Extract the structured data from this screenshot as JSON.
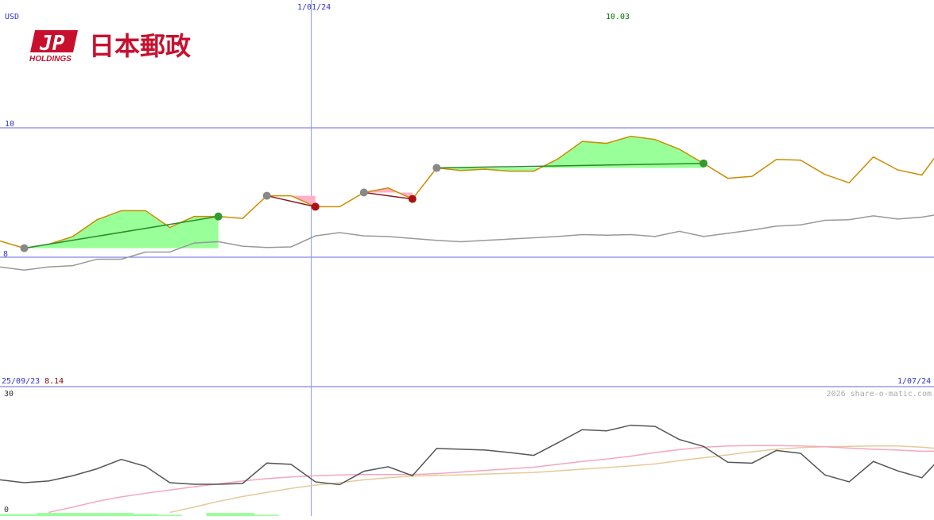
{
  "brand": {
    "logo_mark": "JP",
    "logo_sub": "HOLDINGS",
    "logo_name": "日本郵政",
    "brand_color": "#c8102e"
  },
  "chart_labels": {
    "currency": "USD",
    "date_mid": "1/01/24",
    "date_start": "25/09/23",
    "date_end": "1/07/24",
    "low_value": "8.14",
    "high_value": "10.03",
    "price_tick_10": "10",
    "price_tick_8": "8",
    "ind_tick_30": "30",
    "ind_tick_0": "0",
    "copyright": "2026 share-o-matic.com"
  },
  "colors": {
    "price": "#cc8c00",
    "benchmark": "#999999",
    "gain_fill": "#99ff99",
    "loss_fill": "#ffb0c8",
    "gain_line": "#2a8a2a",
    "loss_line": "#8b1a1a",
    "grid": "#6666dd",
    "indicator": "#555555",
    "ma_fast": "#f4a6bf",
    "ma_slow": "#e6c99a",
    "volume": "#99ff99",
    "high_text": "#007700",
    "low_text": "#8b0000"
  },
  "chart_data": [
    {
      "type": "line",
      "y_unit": "USD",
      "ylim": [
        7.0,
        10.6
      ],
      "grid_y": [
        8,
        10
      ],
      "x_count": 39,
      "x_marker_index": 13,
      "x_tick_labels": [
        {
          "index": 0,
          "label": "25/09/23"
        },
        {
          "index": 13,
          "label": "1/01/24"
        },
        {
          "index": 38,
          "label": "1/07/24"
        }
      ],
      "series": [
        {
          "key": "price",
          "values": [
            8.25,
            8.14,
            8.2,
            8.32,
            8.58,
            8.72,
            8.72,
            8.46,
            8.63,
            8.63,
            8.6,
            8.95,
            8.95,
            8.78,
            8.78,
            9.0,
            9.07,
            8.9,
            9.38,
            9.34,
            9.36,
            9.33,
            9.33,
            9.52,
            9.79,
            9.76,
            9.87,
            9.82,
            9.67,
            9.45,
            9.22,
            9.25,
            9.51,
            9.5,
            9.28,
            9.15,
            9.55,
            9.35,
            9.27,
            9.78
          ]
        },
        {
          "key": "benchmark",
          "values": [
            7.85,
            7.8,
            7.85,
            7.87,
            7.97,
            7.97,
            8.08,
            8.08,
            8.22,
            8.24,
            8.17,
            8.15,
            8.16,
            8.33,
            8.38,
            8.33,
            8.32,
            8.29,
            8.26,
            8.24,
            8.26,
            8.28,
            8.3,
            8.32,
            8.35,
            8.34,
            8.35,
            8.32,
            8.4,
            8.32,
            8.37,
            8.42,
            8.48,
            8.5,
            8.57,
            8.58,
            8.64,
            8.59,
            8.62,
            8.68
          ]
        }
      ],
      "trades": [
        {
          "start_index": 1,
          "end_index": 9,
          "result": "gain"
        },
        {
          "start_index": 11,
          "end_index": 13,
          "result": "loss"
        },
        {
          "start_index": 15,
          "end_index": 17,
          "result": "loss"
        },
        {
          "start_index": 18,
          "end_index": 29,
          "result": "gain"
        }
      ]
    },
    {
      "type": "line",
      "ylim": [
        0,
        30
      ],
      "series": [
        {
          "key": "indicator",
          "values": [
            8.5,
            7.8,
            8.2,
            9.5,
            11.2,
            13.5,
            11.8,
            7.8,
            7.4,
            7.4,
            7.6,
            12.6,
            12.3,
            8.0,
            7.3,
            10.6,
            11.7,
            9.5,
            16.2,
            16.0,
            15.8,
            15.2,
            14.5,
            17.6,
            20.8,
            20.5,
            21.9,
            21.6,
            18.4,
            16.7,
            12.8,
            12.6,
            15.7,
            15.0,
            9.7,
            8.0,
            13.0,
            10.7,
            9.0,
            15.3
          ]
        },
        {
          "key": "ma_fast",
          "values": [
            null,
            null,
            0.5,
            1.8,
            3.2,
            4.3,
            5.2,
            6.0,
            6.8,
            7.5,
            8.2,
            8.8,
            9.2,
            9.5,
            9.7,
            9.8,
            9.8,
            9.8,
            10.0,
            10.4,
            10.8,
            11.2,
            11.6,
            12.3,
            13.0,
            13.6,
            14.3,
            15.2,
            15.9,
            16.5,
            16.8,
            16.9,
            16.9,
            16.8,
            16.6,
            16.3,
            16.0,
            15.8,
            15.5,
            15.5
          ]
        },
        {
          "key": "ma_slow",
          "values": [
            null,
            null,
            null,
            null,
            null,
            null,
            null,
            0.5,
            1.8,
            3.2,
            4.4,
            5.4,
            6.4,
            7.2,
            7.8,
            8.5,
            9.0,
            9.4,
            9.6,
            9.7,
            9.9,
            10.1,
            10.3,
            10.7,
            11.1,
            11.5,
            11.9,
            12.4,
            13.2,
            13.9,
            14.6,
            15.4,
            16.0,
            16.4,
            16.6,
            16.7,
            16.8,
            16.8,
            16.5,
            16.0
          ]
        },
        {
          "key": "volume",
          "values": [
            0.8,
            0.8,
            1.3,
            1.3,
            1.3,
            1.3,
            0.9,
            0.5,
            0.0,
            1.3,
            1.3,
            0.5,
            0,
            0,
            0,
            0,
            0,
            0,
            0,
            0,
            0,
            0,
            0,
            0,
            0,
            0,
            0,
            0,
            0,
            0,
            0,
            0,
            0,
            0,
            0,
            0,
            0,
            0,
            0,
            0
          ]
        }
      ]
    }
  ]
}
